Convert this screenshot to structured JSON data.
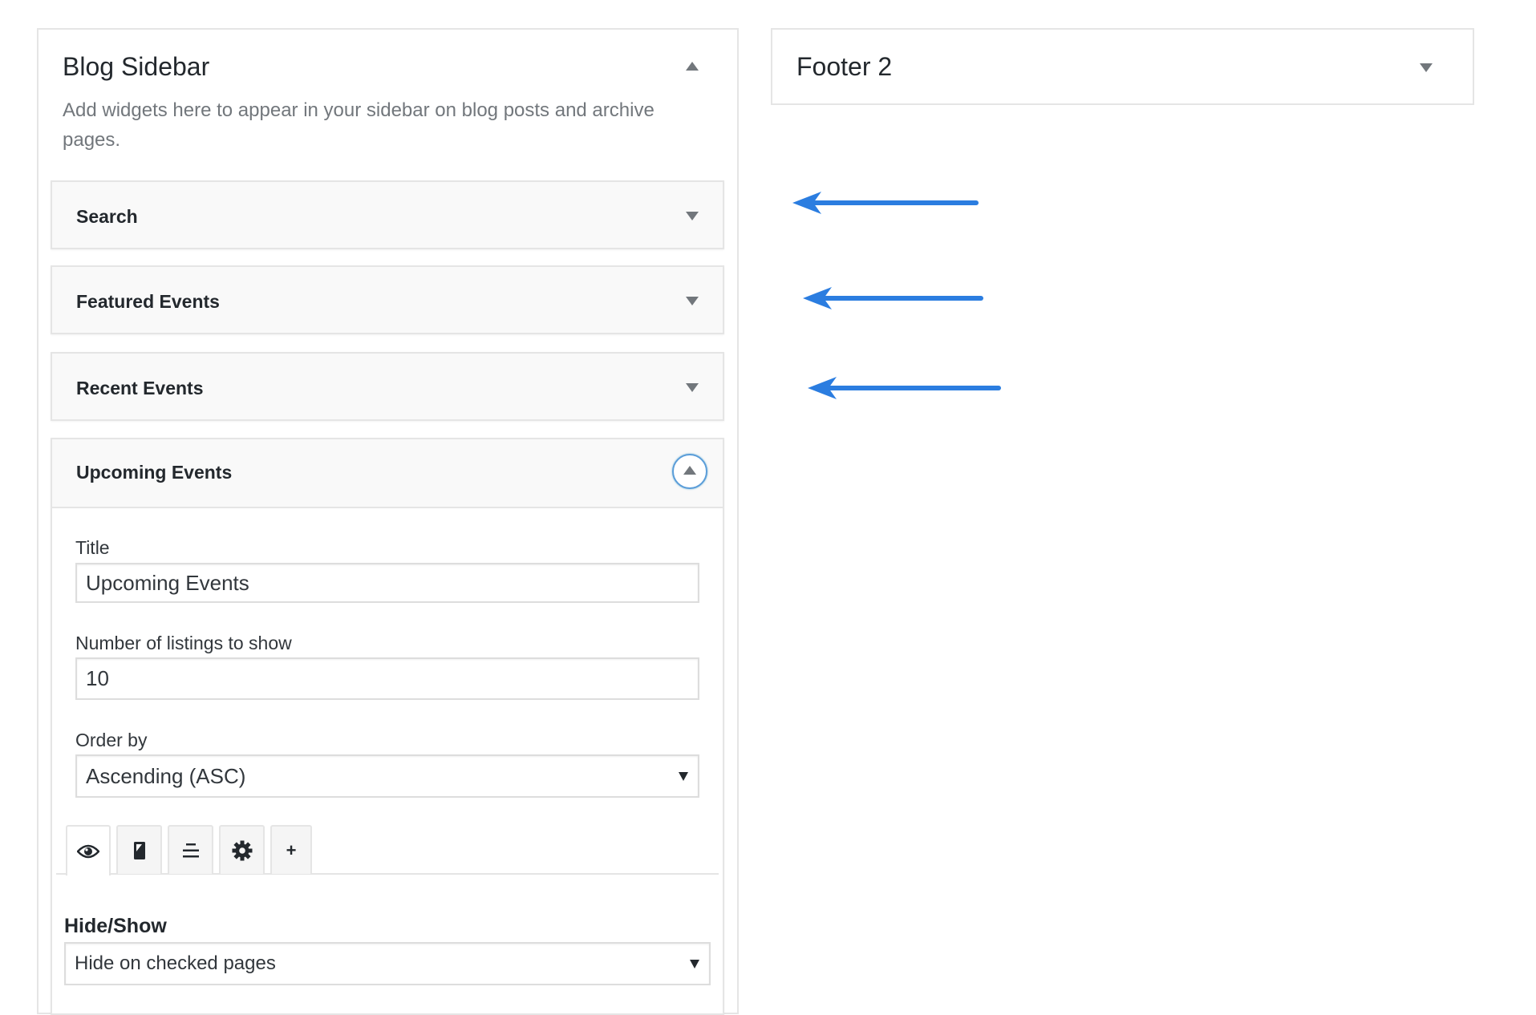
{
  "blog_sidebar": {
    "title": "Blog Sidebar",
    "description": "Add widgets here to appear in your sidebar on blog posts and archive pages.",
    "widgets": [
      {
        "title": "Search",
        "expanded": false
      },
      {
        "title": "Featured Events",
        "expanded": false
      },
      {
        "title": "Recent Events",
        "expanded": false
      },
      {
        "title": "Upcoming Events",
        "expanded": true
      }
    ],
    "upcoming_form": {
      "title_label": "Title",
      "title_value": "Upcoming Events",
      "count_label": "Number of listings to show",
      "count_value": "10",
      "order_label": "Order by",
      "order_value": "Ascending (ASC)",
      "tabs": [
        {
          "icon": "eye-icon",
          "active": true
        },
        {
          "icon": "mobile-icon",
          "active": false
        },
        {
          "icon": "align-center-icon",
          "active": false
        },
        {
          "icon": "gear-icon",
          "active": false
        },
        {
          "icon": "plus-icon",
          "active": false,
          "label": "+"
        }
      ],
      "hide_show_label": "Hide/Show",
      "hide_show_value": "Hide on checked pages"
    }
  },
  "footer2": {
    "title": "Footer 2",
    "expanded": false
  },
  "annotation_arrow_color": "#2b7de0"
}
